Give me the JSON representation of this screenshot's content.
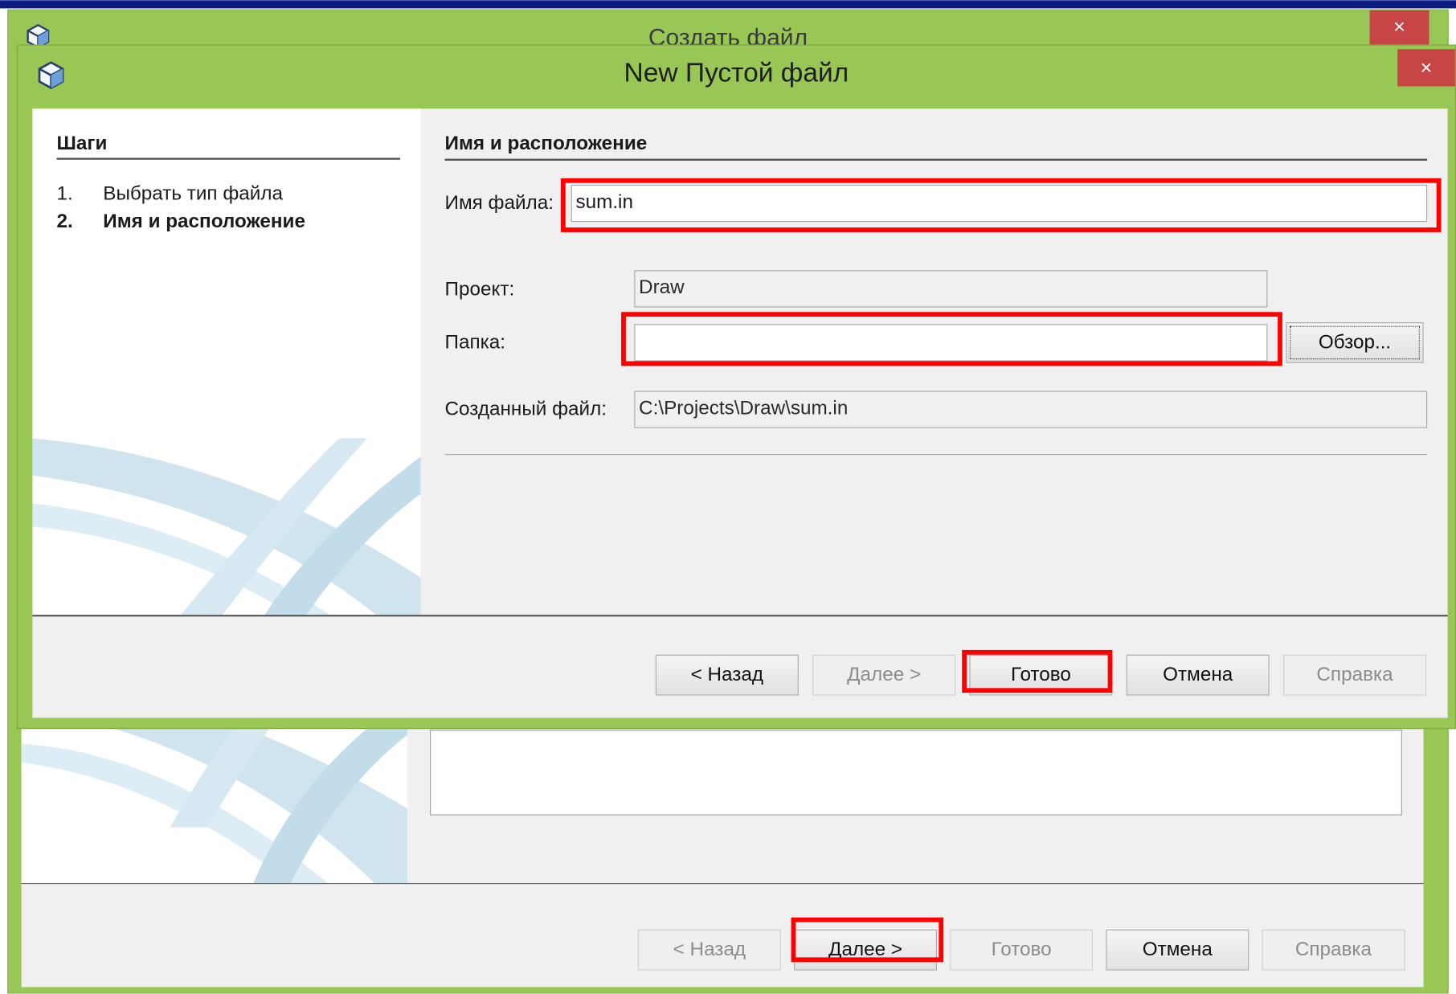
{
  "back_window": {
    "title": "Создать файл",
    "close_glyph": "×",
    "buttons": {
      "back": "< Назад",
      "next": "Далее >",
      "finish": "Готово",
      "cancel": "Отмена",
      "help": "Справка"
    }
  },
  "front_window": {
    "title": "New Пустой файл",
    "close_glyph": "×",
    "steps": {
      "title": "Шаги",
      "items": [
        {
          "num": "1.",
          "label": "Выбрать тип файла"
        },
        {
          "num": "2.",
          "label": "Имя и расположение"
        }
      ]
    },
    "form": {
      "section_title": "Имя и расположение",
      "filename_label": "Имя файла:",
      "filename_value": "sum.in",
      "project_label": "Проект:",
      "project_value": "Draw",
      "folder_label": "Папка:",
      "folder_value": "",
      "browse_button": "Обзор...",
      "created_label": "Созданный файл:",
      "created_value": "C:\\Projects\\Draw\\sum.in"
    },
    "buttons": {
      "back": "< Назад",
      "next": "Далее >",
      "finish": "Готово",
      "cancel": "Отмена",
      "help": "Справка"
    }
  },
  "colors": {
    "window_frame": "#98c756",
    "close_button": "#c84545",
    "highlight": "#ff0000"
  },
  "icons": [
    "app-cube-icon",
    "close-icon",
    "decorative-swoosh"
  ]
}
